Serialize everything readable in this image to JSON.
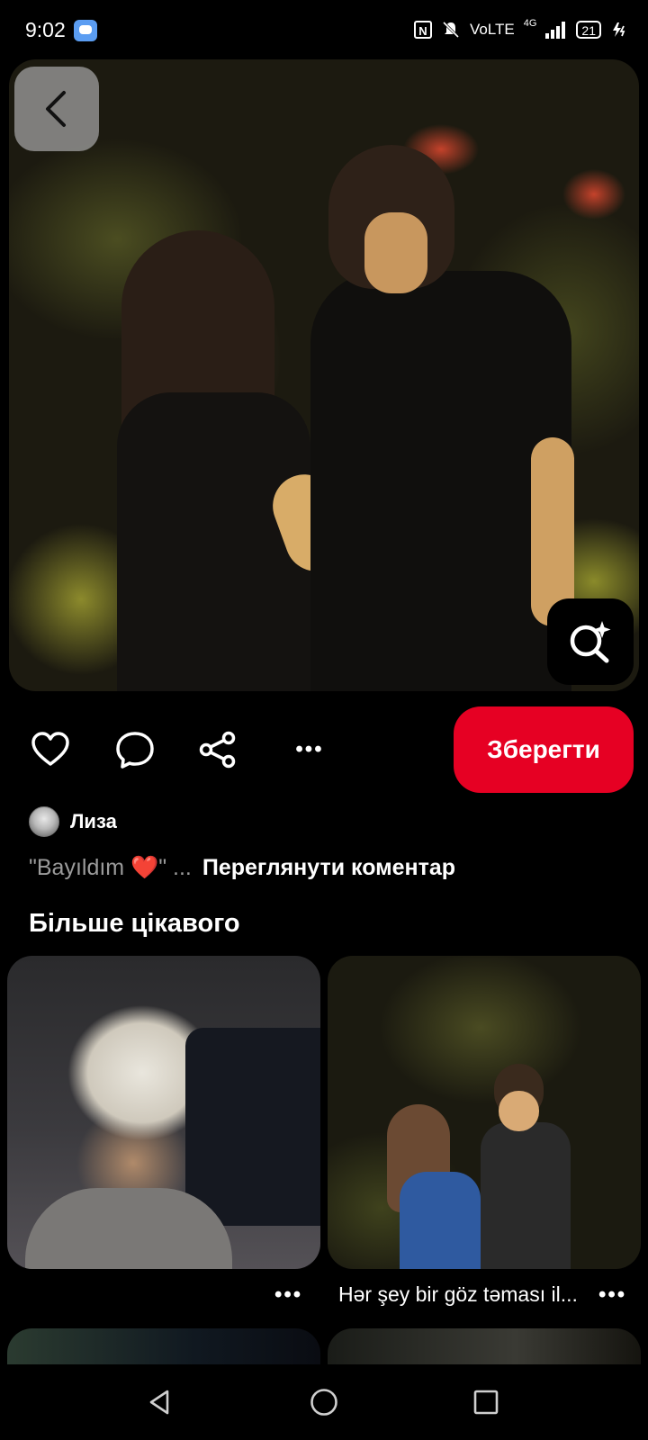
{
  "status_bar": {
    "time": "9:02",
    "network_label": "VoLTE",
    "network_type": "4G",
    "battery": "21",
    "icons": [
      "messages-icon",
      "nfc-icon",
      "mute-icon",
      "signal-icon",
      "battery-icon",
      "charging-icon"
    ]
  },
  "hero": {
    "back_icon": "chevron-left-icon",
    "visual_search_icon": "sparkle-search-icon"
  },
  "actions": {
    "like_icon": "heart-icon",
    "comment_icon": "comment-bubble-icon",
    "share_icon": "share-icon",
    "more_label": "•••",
    "save_label": "Зберегти",
    "save_color": "#e60023"
  },
  "author": {
    "name": "Лиза"
  },
  "comment": {
    "quote": "\"Bayıldım ❤️\" ...",
    "view_link": "Переглянути коментар"
  },
  "more_section": {
    "title": "Більше цікавого",
    "pins": [
      {
        "caption": "",
        "more_label": "•••"
      },
      {
        "caption": "Hər şey bir göz təması il...",
        "more_label": "•••"
      }
    ]
  },
  "nav_bar": {
    "buttons": [
      "back-triangle-icon",
      "home-circle-icon",
      "recents-square-icon"
    ]
  }
}
